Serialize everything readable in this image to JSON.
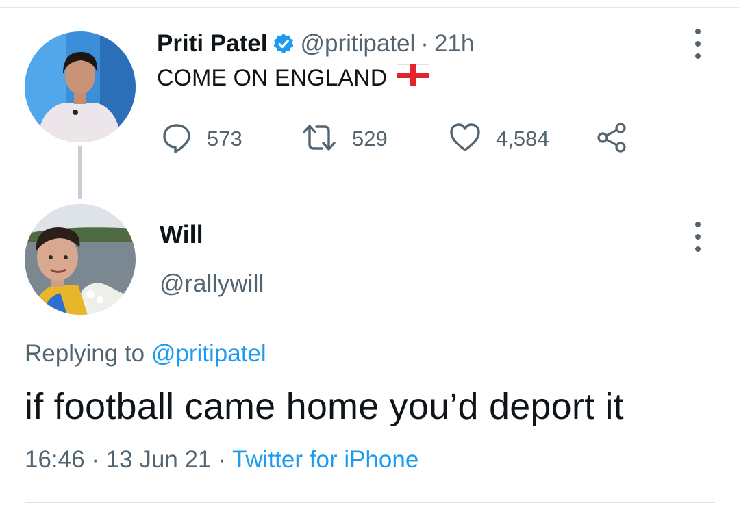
{
  "original_tweet": {
    "author_name": "Priti Patel",
    "handle": "@pritipatel",
    "separator": "·",
    "time_ago": "21h",
    "verified": true,
    "text": "COME ON ENGLAND",
    "emoji": "england-flag",
    "stats": {
      "replies": "573",
      "retweets": "529",
      "likes": "4,584"
    }
  },
  "reply_tweet": {
    "author_name": "Will",
    "handle": "@rallywill",
    "replying_label": "Replying to",
    "replying_to": "@pritipatel",
    "text": "if football came home you’d deport it",
    "time": "16:46",
    "separator": "·",
    "date": "13 Jun 21",
    "separator2": "·",
    "source": "Twitter for iPhone"
  },
  "icons": {
    "reply": "speech-bubble-icon",
    "retweet": "retweet-arrows-icon",
    "like": "heart-icon",
    "share": "share-nodes-icon",
    "more": "vertical-ellipsis-icon",
    "verified": "verified-badge-icon"
  },
  "colors": {
    "accent": "#1d9bf0",
    "secondary_text": "#536471",
    "primary_text": "#0f1419",
    "thread_line": "#c4cfd6",
    "flag_red": "#e0252f"
  }
}
